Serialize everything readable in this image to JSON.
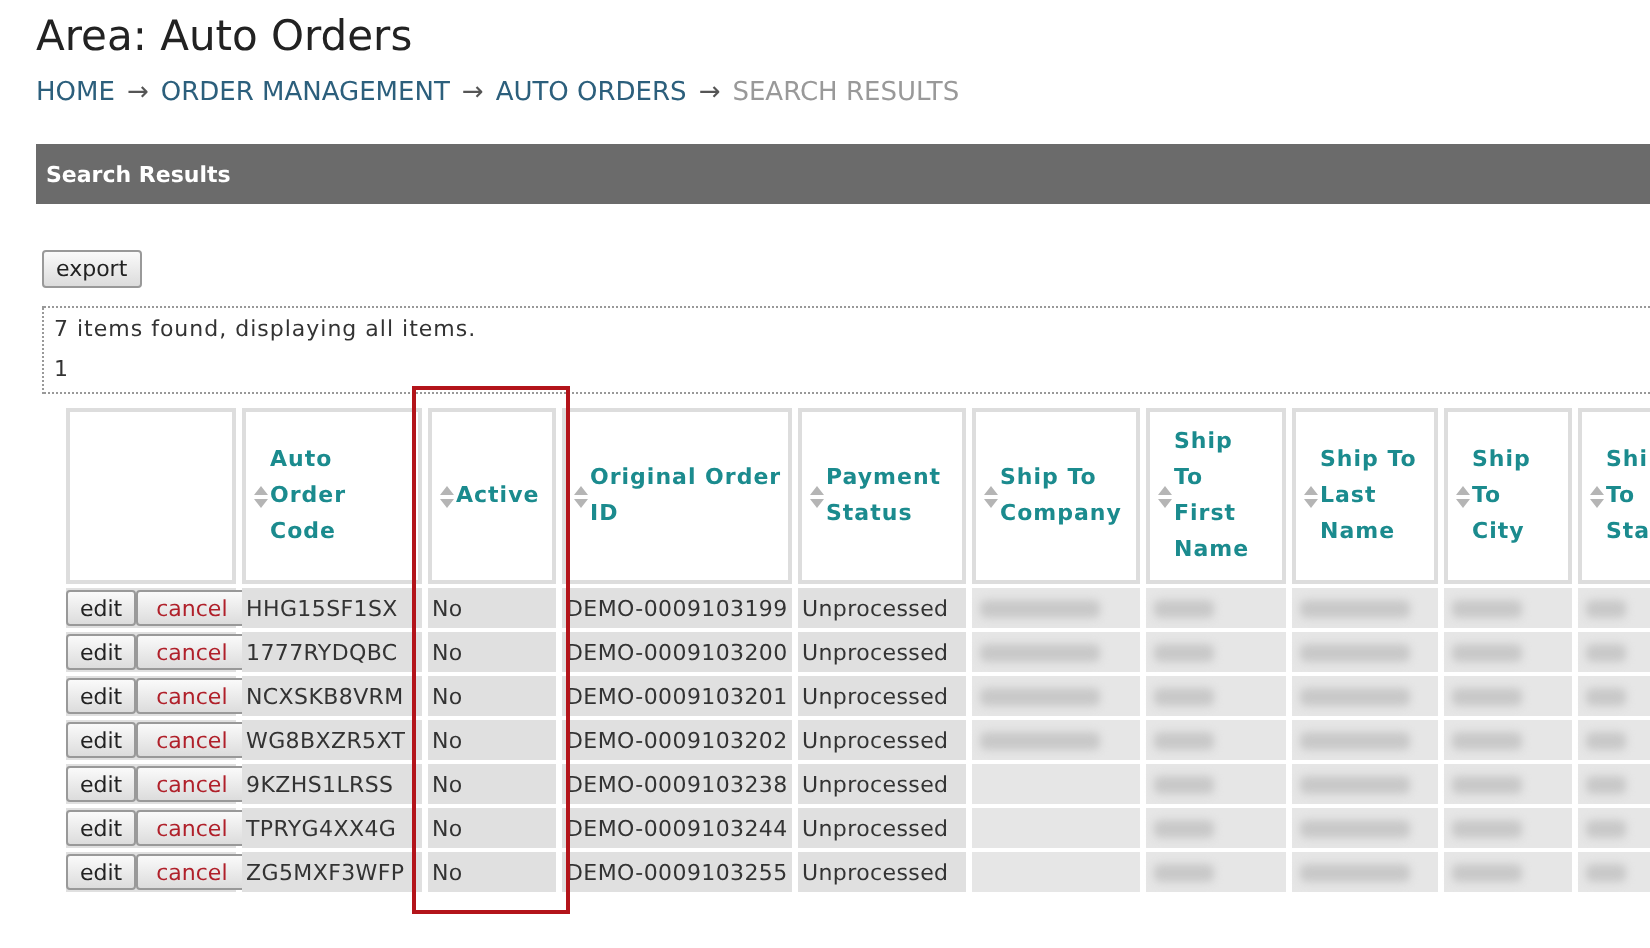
{
  "page_title": "Area: Auto Orders",
  "breadcrumb": {
    "separator": "→",
    "items": [
      {
        "label": "HOME",
        "current": false
      },
      {
        "label": "ORDER MANAGEMENT",
        "current": false
      },
      {
        "label": "AUTO ORDERS",
        "current": false
      },
      {
        "label": "SEARCH RESULTS",
        "current": true
      }
    ]
  },
  "panel_title": "Search Results",
  "export_button": "export",
  "summary": "7 items found, displaying all items.",
  "pages": [
    "1"
  ],
  "table": {
    "columns": [
      {
        "sortable": false,
        "highlighted": false
      },
      {
        "lines": [
          "Auto",
          "Order",
          "Code"
        ],
        "sortable": true,
        "highlighted": false
      },
      {
        "lines": [
          "Active"
        ],
        "sortable": true,
        "highlighted": true
      },
      {
        "lines": [
          "Original Order",
          "ID"
        ],
        "sortable": true,
        "highlighted": false
      },
      {
        "lines": [
          "Payment",
          "Status"
        ],
        "sortable": true,
        "highlighted": false
      },
      {
        "lines": [
          "Ship To",
          "Company"
        ],
        "sortable": true,
        "highlighted": false
      },
      {
        "lines": [
          "Ship",
          "To",
          "First",
          "Name"
        ],
        "sortable": true,
        "highlighted": false
      },
      {
        "lines": [
          "Ship To",
          "Last",
          "Name"
        ],
        "sortable": true,
        "highlighted": false
      },
      {
        "lines": [
          "Ship",
          "To",
          "City"
        ],
        "sortable": true,
        "highlighted": false
      },
      {
        "lines": [
          "Shi",
          "To",
          "Sta"
        ],
        "sortable": true,
        "highlighted": false
      }
    ],
    "rows": [
      {
        "edit": "edit",
        "cancel": "cancel",
        "code": "HHG15SF1SX",
        "active": "No",
        "original_order_id": "DEMO-0009103199",
        "payment_status": "Unprocessed",
        "company_blurred": true
      },
      {
        "edit": "edit",
        "cancel": "cancel",
        "code": "1777RYDQBC",
        "active": "No",
        "original_order_id": "DEMO-0009103200",
        "payment_status": "Unprocessed",
        "company_blurred": true
      },
      {
        "edit": "edit",
        "cancel": "cancel",
        "code": "NCXSKB8VRM",
        "active": "No",
        "original_order_id": "DEMO-0009103201",
        "payment_status": "Unprocessed",
        "company_blurred": true
      },
      {
        "edit": "edit",
        "cancel": "cancel",
        "code": "WG8BXZR5XT",
        "active": "No",
        "original_order_id": "DEMO-0009103202",
        "payment_status": "Unprocessed",
        "company_blurred": true
      },
      {
        "edit": "edit",
        "cancel": "cancel",
        "code": "9KZHS1LRSS",
        "active": "No",
        "original_order_id": "DEMO-0009103238",
        "payment_status": "Unprocessed",
        "company_blurred": false
      },
      {
        "edit": "edit",
        "cancel": "cancel",
        "code": "TPRYG4XX4G",
        "active": "No",
        "original_order_id": "DEMO-0009103244",
        "payment_status": "Unprocessed",
        "company_blurred": false
      },
      {
        "edit": "edit",
        "cancel": "cancel",
        "code": "ZG5MXF3WFP",
        "active": "No",
        "original_order_id": "DEMO-0009103255",
        "payment_status": "Unprocessed",
        "company_blurred": false
      }
    ]
  }
}
